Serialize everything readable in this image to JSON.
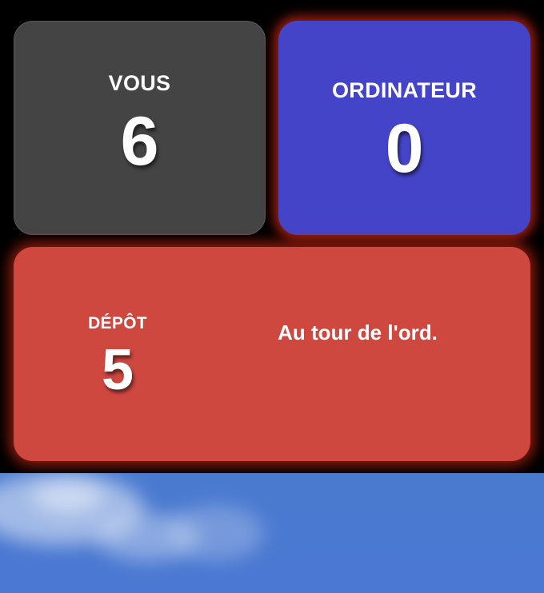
{
  "scoreboard": {
    "player": {
      "label": "VOUS",
      "score": "6"
    },
    "computer": {
      "label": "ORDINATEUR",
      "score": "0"
    }
  },
  "pile": {
    "label": "DÉPÔT",
    "count": "5"
  },
  "status": {
    "turn_message": "Au tour de l'ord."
  },
  "colors": {
    "player_card": "#444444",
    "computer_card": "#4444c8",
    "pile_card": "#cf4840",
    "active_glow": "#d22814",
    "sky": "#4a7ad0"
  }
}
